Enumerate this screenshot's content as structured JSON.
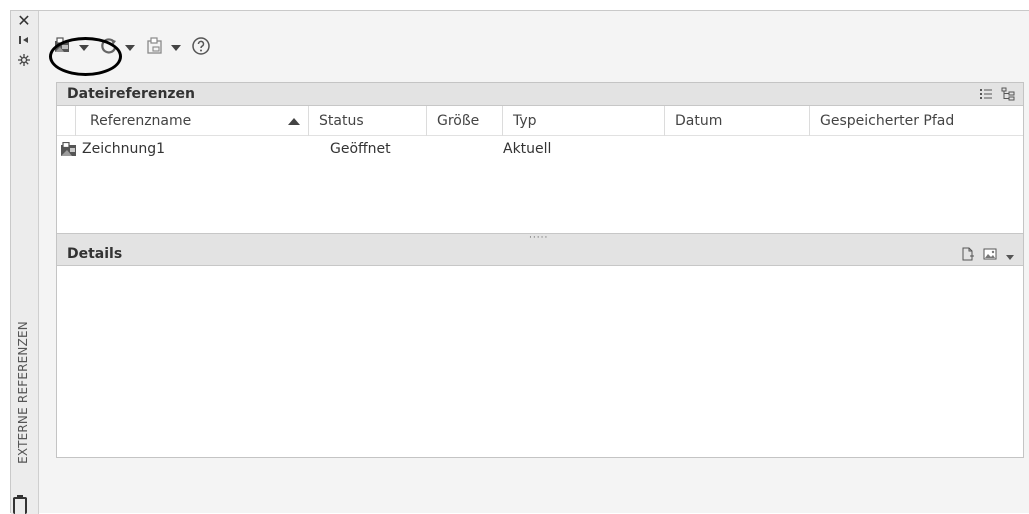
{
  "palette": {
    "side_title": "EXTERNE REFERENZEN",
    "close_icon": "close-icon",
    "autohide_icon": "autohide-icon",
    "properties_icon": "properties-icon"
  },
  "toolbar": {
    "attach_icon": "attach-dwg-icon",
    "refresh_icon": "refresh-icon",
    "change_path_icon": "change-path-icon",
    "help_icon": "help-icon"
  },
  "file_references": {
    "title": "Dateireferenzen",
    "columns": [
      "Referenzname",
      "Status",
      "Größe",
      "Typ",
      "Datum",
      "Gespeicherter Pfad"
    ],
    "sort_column": "Referenzname",
    "rows": [
      {
        "name": "Zeichnung1",
        "status": "Geöffnet",
        "size": "",
        "type": "Aktuell",
        "date": "",
        "path": ""
      }
    ]
  },
  "details": {
    "title": "Details"
  },
  "colors": {
    "header_bg": "#e3e3e3",
    "panel_bg": "#f4f4f4",
    "highlight_ring": "#000000"
  }
}
